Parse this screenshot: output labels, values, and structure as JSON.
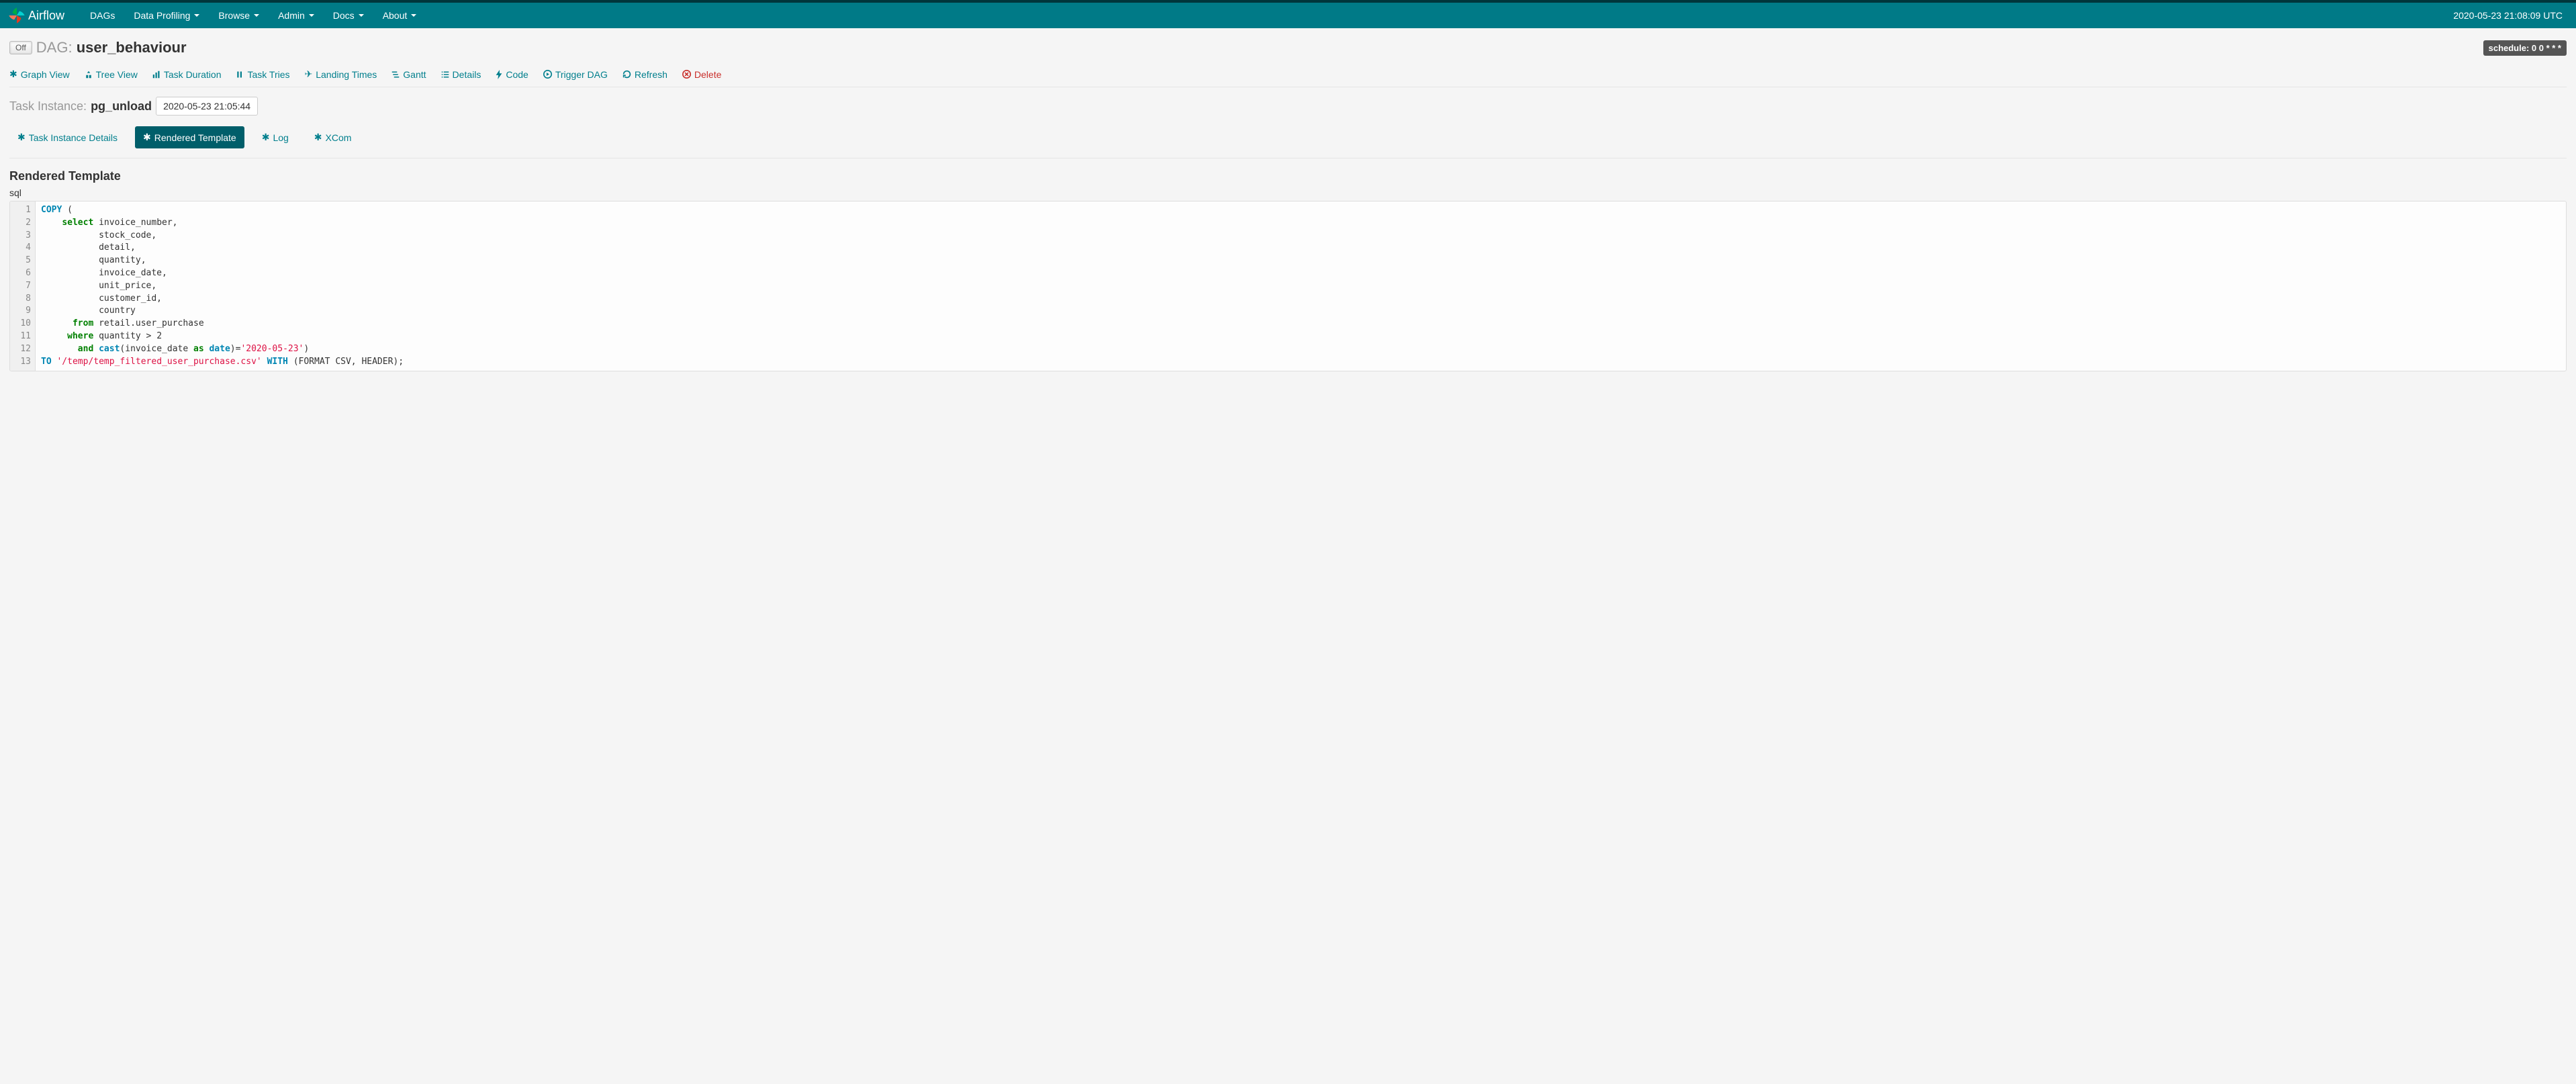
{
  "navbar": {
    "brand": "Airflow",
    "items": [
      {
        "label": "DAGs",
        "dropdown": false
      },
      {
        "label": "Data Profiling",
        "dropdown": true
      },
      {
        "label": "Browse",
        "dropdown": true
      },
      {
        "label": "Admin",
        "dropdown": true
      },
      {
        "label": "Docs",
        "dropdown": true
      },
      {
        "label": "About",
        "dropdown": true
      }
    ],
    "clock": "2020-05-23 21:08:09 UTC"
  },
  "dag": {
    "toggle": "Off",
    "prefix": "DAG:",
    "name": "user_behaviour",
    "schedule_label": "schedule: 0 0 * * *"
  },
  "tabs": {
    "graph_view": "Graph View",
    "tree_view": "Tree View",
    "task_duration": "Task Duration",
    "task_tries": "Task Tries",
    "landing_times": "Landing Times",
    "gantt": "Gantt",
    "details": "Details",
    "code": "Code",
    "trigger_dag": "Trigger DAG",
    "refresh": "Refresh",
    "delete": "Delete"
  },
  "task_instance": {
    "label": "Task Instance:",
    "name": "pg_unload",
    "execution_date": "2020-05-23 21:05:44"
  },
  "subtabs": {
    "details": "Task Instance Details",
    "rendered": "Rendered Template",
    "log": "Log",
    "xcom": "XCom"
  },
  "section": {
    "title": "Rendered Template",
    "label": "sql"
  },
  "code": {
    "line_count": 13,
    "lines": [
      {
        "n": 1,
        "tokens": [
          {
            "t": "COPY",
            "c": "kw-blue"
          },
          {
            "t": " (",
            "c": "punct"
          }
        ]
      },
      {
        "n": 2,
        "tokens": [
          {
            "t": "    ",
            "c": ""
          },
          {
            "t": "select",
            "c": "kw-green"
          },
          {
            "t": " invoice_number,",
            "c": "punct"
          }
        ]
      },
      {
        "n": 3,
        "tokens": [
          {
            "t": "           stock_code,",
            "c": "punct"
          }
        ]
      },
      {
        "n": 4,
        "tokens": [
          {
            "t": "           detail,",
            "c": "punct"
          }
        ]
      },
      {
        "n": 5,
        "tokens": [
          {
            "t": "           quantity,",
            "c": "punct"
          }
        ]
      },
      {
        "n": 6,
        "tokens": [
          {
            "t": "           invoice_date,",
            "c": "punct"
          }
        ]
      },
      {
        "n": 7,
        "tokens": [
          {
            "t": "           unit_price,",
            "c": "punct"
          }
        ]
      },
      {
        "n": 8,
        "tokens": [
          {
            "t": "           customer_id,",
            "c": "punct"
          }
        ]
      },
      {
        "n": 9,
        "tokens": [
          {
            "t": "           country",
            "c": "punct"
          }
        ]
      },
      {
        "n": 10,
        "tokens": [
          {
            "t": "      ",
            "c": ""
          },
          {
            "t": "from",
            "c": "kw-green"
          },
          {
            "t": " retail.user_purchase",
            "c": "punct"
          }
        ]
      },
      {
        "n": 11,
        "tokens": [
          {
            "t": "     ",
            "c": ""
          },
          {
            "t": "where",
            "c": "kw-green"
          },
          {
            "t": " quantity > 2",
            "c": "punct"
          }
        ]
      },
      {
        "n": 12,
        "tokens": [
          {
            "t": "       ",
            "c": ""
          },
          {
            "t": "and",
            "c": "kw-green"
          },
          {
            "t": " ",
            "c": ""
          },
          {
            "t": "cast",
            "c": "kw-blue"
          },
          {
            "t": "(invoice_date ",
            "c": "punct"
          },
          {
            "t": "as",
            "c": "kw-green"
          },
          {
            "t": " ",
            "c": ""
          },
          {
            "t": "date",
            "c": "kw-blue"
          },
          {
            "t": ")=",
            "c": "punct"
          },
          {
            "t": "'2020-05-23'",
            "c": "str-red"
          },
          {
            "t": ")",
            "c": "punct"
          }
        ]
      },
      {
        "n": 13,
        "tokens": [
          {
            "t": "TO",
            "c": "kw-blue"
          },
          {
            "t": " ",
            "c": ""
          },
          {
            "t": "'/temp/temp_filtered_user_purchase.csv'",
            "c": "str-red"
          },
          {
            "t": " ",
            "c": ""
          },
          {
            "t": "WITH",
            "c": "kw-blue"
          },
          {
            "t": " (FORMAT CSV, HEADER);",
            "c": "punct"
          }
        ]
      }
    ]
  }
}
